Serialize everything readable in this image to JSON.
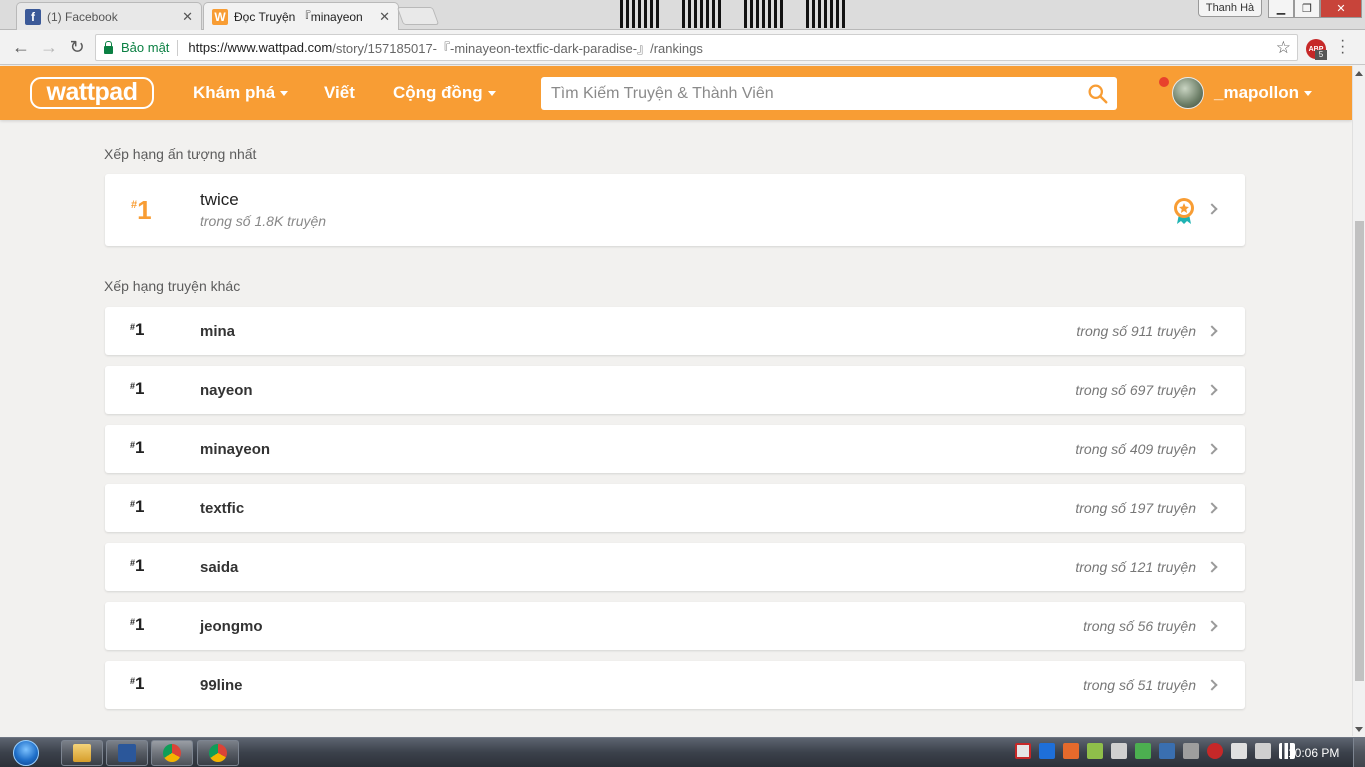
{
  "browser": {
    "tabs": [
      {
        "label": "(1) Facebook",
        "favicon": "facebook-icon",
        "color": "#3b5998"
      },
      {
        "label": "Đọc Truyện 『minayeon",
        "favicon": "wattpad-icon",
        "color": "#f89d34"
      }
    ],
    "user_chip": "Thanh Hà",
    "secure_label": "Bảo mật",
    "url_main": "https://www.wattpad.com",
    "url_rest": "/story/157185017-『-minayeon-textfic-dark-paradise-』/rankings",
    "extension_badge": "5",
    "extension_label": "ABP"
  },
  "header": {
    "logo": "wattpad",
    "nav": [
      "Khám phá",
      "Viết",
      "Cộng đồng"
    ],
    "search_placeholder": "Tìm Kiếm Truyện & Thành Viên",
    "username": "_mapollon",
    "brand_color": "#f89d34"
  },
  "main": {
    "featured_title": "Xếp hạng ấn tượng nhất",
    "featured": {
      "hash": "#",
      "rank": "1",
      "tag": "twice",
      "count": "trong số 1.8K truyện"
    },
    "other_title": "Xếp hạng truyện khác",
    "rankings": [
      {
        "hash": "#",
        "rank": "1",
        "tag": "mina",
        "count": "trong số 911 truyện"
      },
      {
        "hash": "#",
        "rank": "1",
        "tag": "nayeon",
        "count": "trong số 697 truyện"
      },
      {
        "hash": "#",
        "rank": "1",
        "tag": "minayeon",
        "count": "trong số 409 truyện"
      },
      {
        "hash": "#",
        "rank": "1",
        "tag": "textfic",
        "count": "trong số 197 truyện"
      },
      {
        "hash": "#",
        "rank": "1",
        "tag": "saida",
        "count": "trong số 121 truyện"
      },
      {
        "hash": "#",
        "rank": "1",
        "tag": "jeongmo",
        "count": "trong số 56 truyện"
      },
      {
        "hash": "#",
        "rank": "1",
        "tag": "99line",
        "count": "trong số 51 truyện"
      }
    ]
  },
  "taskbar": {
    "clock": "10:06 PM"
  }
}
